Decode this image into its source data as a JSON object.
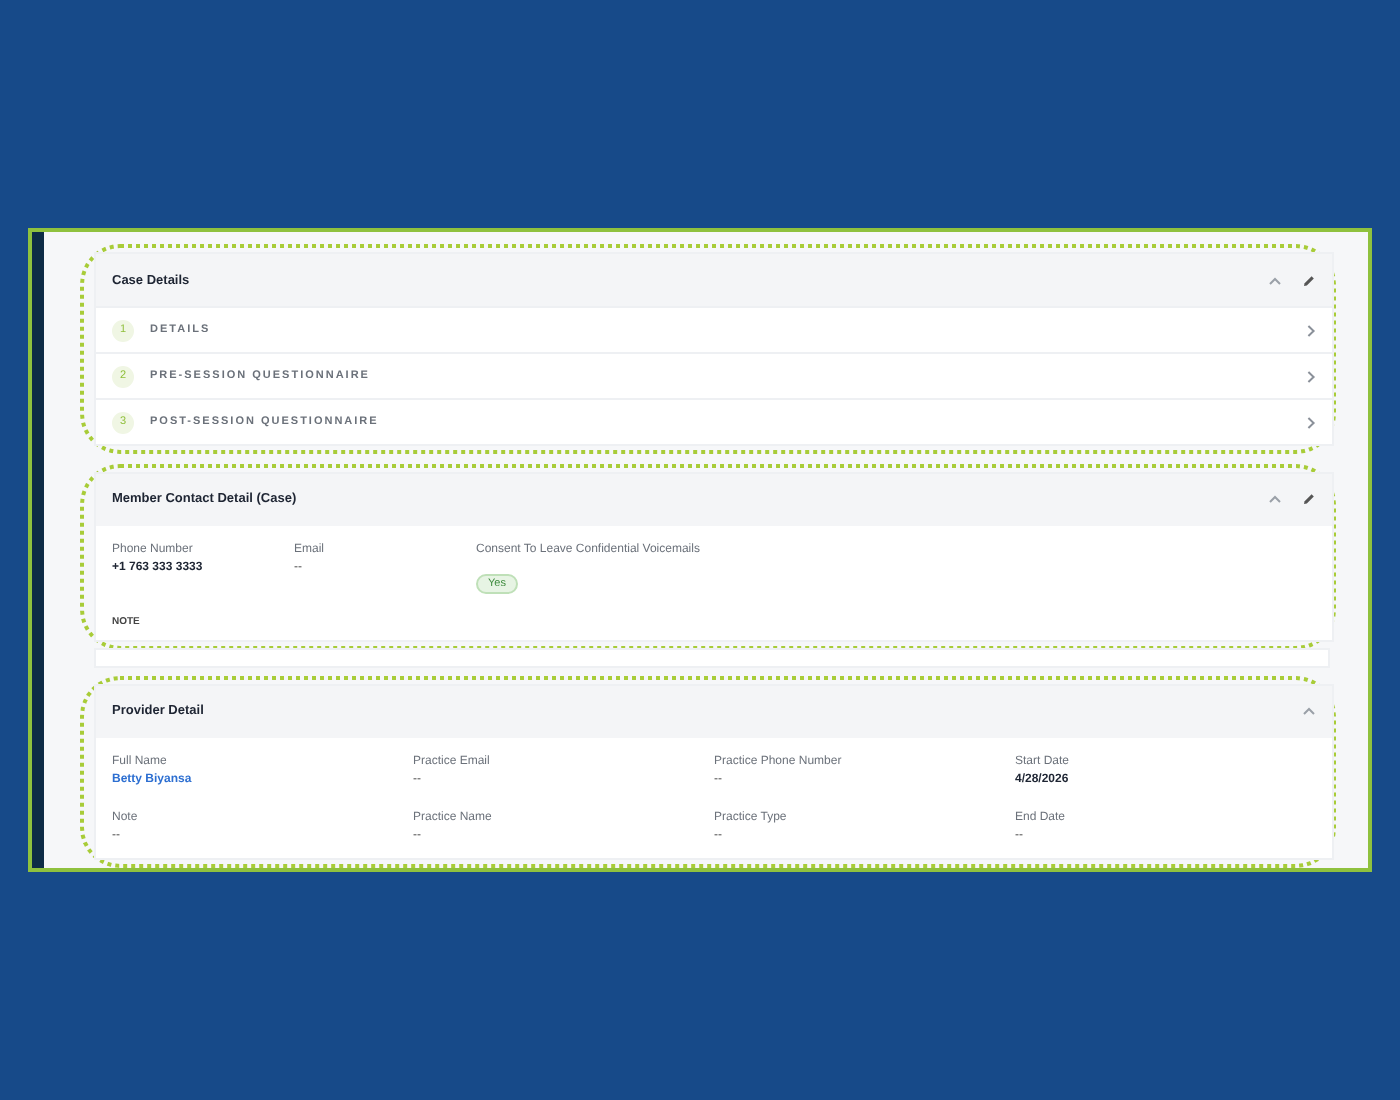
{
  "case_details": {
    "title": "Case Details",
    "steps": [
      {
        "number": "1",
        "label": "DETAILS"
      },
      {
        "number": "2",
        "label": "PRE-SESSION QUESTIONNAIRE"
      },
      {
        "number": "3",
        "label": "POST-SESSION QUESTIONNAIRE"
      }
    ]
  },
  "member_contact": {
    "title": "Member Contact Detail (Case)",
    "fields": [
      {
        "label": "Phone Number",
        "value": "+1 763 333 3333",
        "kind": "strong"
      },
      {
        "label": "Email",
        "value": "--",
        "kind": "plain"
      },
      {
        "label": "Consent To Leave Confidential Voicemails",
        "value": "Yes",
        "kind": "badge"
      }
    ],
    "note_label": "NOTE"
  },
  "provider_detail": {
    "title": "Provider Detail",
    "fields": [
      {
        "label": "Full Name",
        "value": "Betty Biyansa",
        "kind": "link"
      },
      {
        "label": "Practice Email",
        "value": "--",
        "kind": "plain"
      },
      {
        "label": "Practice Phone Number",
        "value": "--",
        "kind": "plain"
      },
      {
        "label": "Start Date",
        "value": "4/28/2026",
        "kind": "strong"
      },
      {
        "label": "Note",
        "value": "--",
        "kind": "plain"
      },
      {
        "label": "Practice Name",
        "value": "--",
        "kind": "plain"
      },
      {
        "label": "Practice Type",
        "value": "--",
        "kind": "plain"
      },
      {
        "label": "End Date",
        "value": "--",
        "kind": "plain"
      }
    ]
  }
}
